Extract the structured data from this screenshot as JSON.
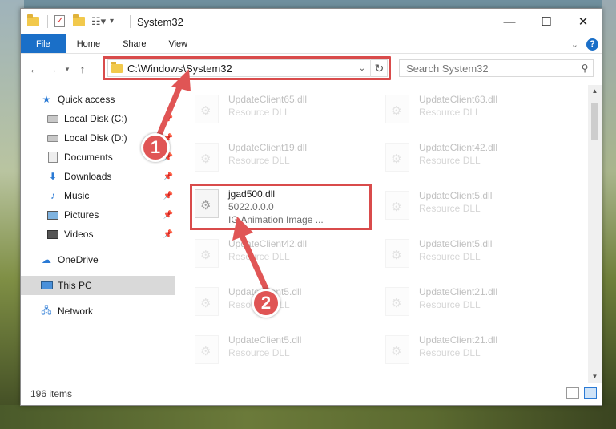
{
  "window": {
    "title": "System32",
    "min_glyph": "—",
    "max_glyph": "☐",
    "close_glyph": "✕"
  },
  "ribbon": {
    "tabs": [
      "File",
      "Home",
      "Share",
      "View"
    ]
  },
  "address": {
    "path": "C:\\Windows\\System32"
  },
  "search": {
    "placeholder": "Search System32"
  },
  "sidebar": {
    "items": [
      {
        "label": "Quick access",
        "icon": "star-icon"
      },
      {
        "label": "Local Disk (C:)",
        "icon": "drive-icon"
      },
      {
        "label": "Local Disk (D:)",
        "icon": "drive-icon"
      },
      {
        "label": "Documents",
        "icon": "documents-icon"
      },
      {
        "label": "Downloads",
        "icon": "downloads-icon"
      },
      {
        "label": "Music",
        "icon": "music-icon"
      },
      {
        "label": "Pictures",
        "icon": "pictures-icon"
      },
      {
        "label": "Videos",
        "icon": "videos-icon"
      },
      {
        "label": "OneDrive",
        "icon": "onedrive-icon"
      },
      {
        "label": "This PC",
        "icon": "pc-icon"
      },
      {
        "label": "Network",
        "icon": "network-icon"
      }
    ]
  },
  "files": {
    "left": [
      {
        "name": "UpdateClient65.dll",
        "desc": "Resource DLL"
      },
      {
        "name": "UpdateClient19.dll",
        "desc": "Resource DLL"
      },
      {
        "name": "jgad500.dll",
        "version": "5022.0.0.0",
        "desc": "IG Animation Image ..."
      },
      {
        "name": "UpdateClient42.dll",
        "desc": "Resource DLL"
      },
      {
        "name": "UpdateClient5.dll",
        "desc": "Resource DLL"
      },
      {
        "name": "UpdateClient5.dll",
        "desc": "Resource DLL"
      }
    ],
    "right": [
      {
        "name": "UpdateClient63.dll",
        "desc": "Resource DLL"
      },
      {
        "name": "UpdateClient42.dll",
        "desc": "Resource DLL"
      },
      {
        "name": "UpdateClient5.dll",
        "desc": "Resource DLL"
      },
      {
        "name": "UpdateClient5.dll",
        "desc": "Resource DLL"
      },
      {
        "name": "UpdateClient21.dll",
        "desc": "Resource DLL"
      },
      {
        "name": "UpdateClient21.dll",
        "desc": "Resource DLL"
      }
    ]
  },
  "status": {
    "item_count": "196 items"
  },
  "callouts": {
    "one": "1",
    "two": "2"
  },
  "colors": {
    "accent": "#1a6fc8",
    "highlight": "#d94b4b",
    "callout": "#e05555"
  }
}
